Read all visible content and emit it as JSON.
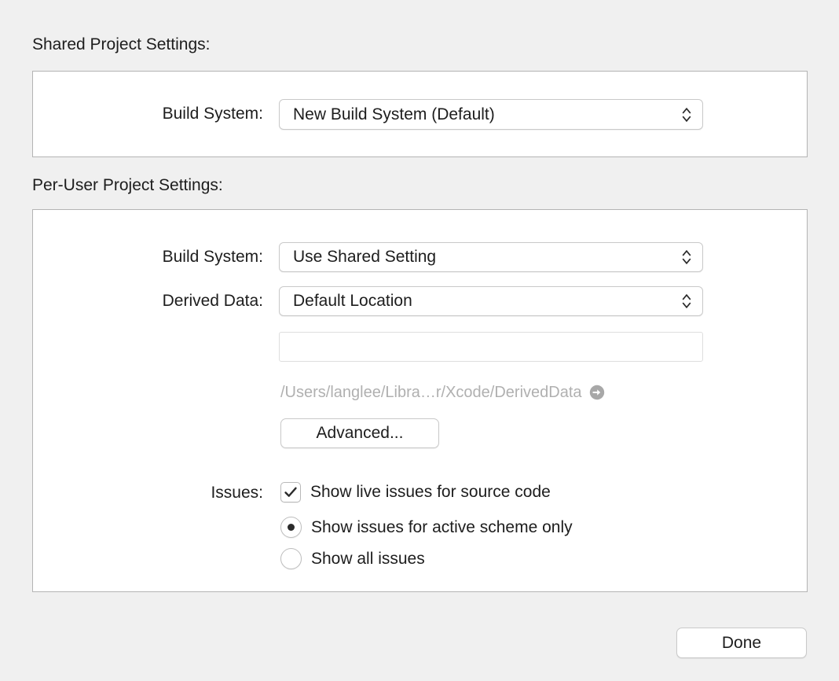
{
  "shared": {
    "heading": "Shared Project Settings:",
    "build_system": {
      "label": "Build System:",
      "value": "New Build System (Default)"
    }
  },
  "per_user": {
    "heading": "Per-User Project Settings:",
    "build_system": {
      "label": "Build System:",
      "value": "Use Shared Setting"
    },
    "derived_data": {
      "label": "Derived Data:",
      "value": "Default Location",
      "custom_path_value": "",
      "custom_path_placeholder": "",
      "resolved_path": "/Users/langlee/Libra…r/Xcode/DerivedData",
      "reveal_icon": "arrow-right-circle-icon"
    },
    "advanced_button": "Advanced...",
    "issues": {
      "label": "Issues:",
      "live_issues": {
        "text": "Show live issues for source code",
        "checked": true
      },
      "options": [
        {
          "text": "Show issues for active scheme only",
          "selected": true
        },
        {
          "text": "Show all issues",
          "selected": false
        }
      ]
    }
  },
  "footer": {
    "done_button": "Done"
  },
  "colors": {
    "window_background": "#f0f0f0",
    "panel_background": "#ffffff",
    "panel_border": "#b4b4b4",
    "text": "#1d1d1d",
    "muted_text": "#b0b0b0",
    "control_border": "#c9c9c9"
  },
  "icons": {
    "popup_chevrons": "chevron-up-down-icon"
  }
}
